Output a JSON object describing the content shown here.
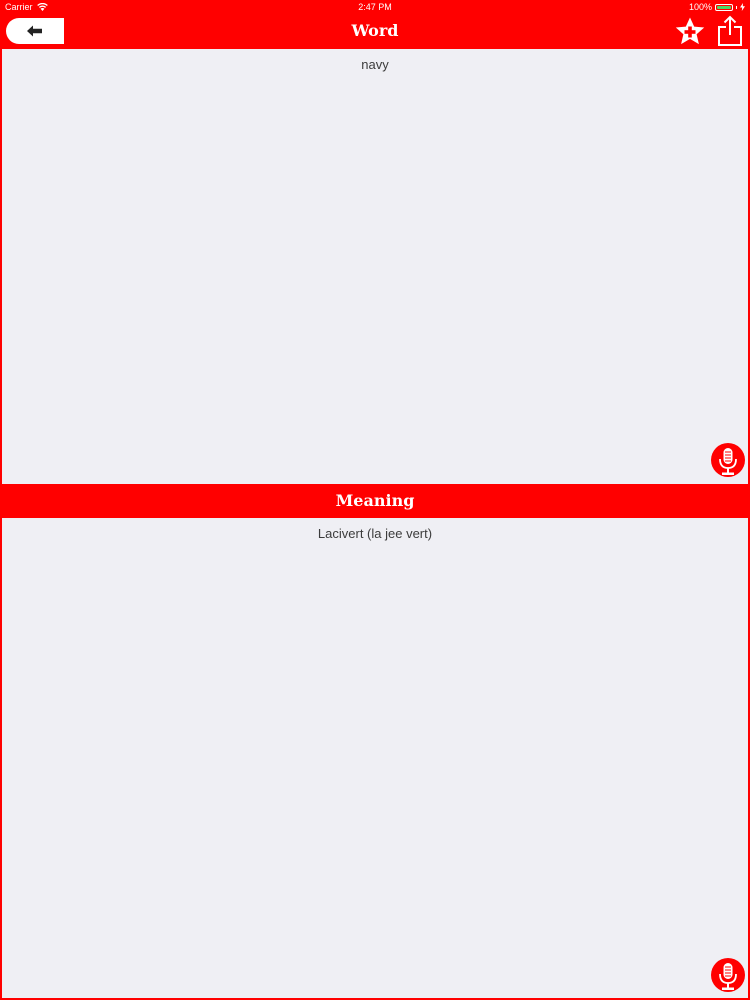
{
  "status_bar": {
    "carrier": "Carrier",
    "time": "2:47 PM",
    "battery_percent": "100%",
    "battery_level": 1.0,
    "wifi_icon": "wifi-icon",
    "battery_icon": "battery-icon"
  },
  "nav": {
    "title": "Word",
    "back_icon": "arrow-left-icon",
    "favorite_icon": "star-plus-icon",
    "share_icon": "share-icon"
  },
  "word_panel": {
    "text": "navy",
    "speak_icon": "microphone-icon"
  },
  "meaning_section": {
    "header": "Meaning",
    "text": "Lacivert (la jee vert)",
    "speak_icon": "microphone-icon"
  },
  "colors": {
    "accent": "#ff0000",
    "panel_background": "#efeff4",
    "text": "#3c3c3c",
    "battery": "#4cd964"
  }
}
